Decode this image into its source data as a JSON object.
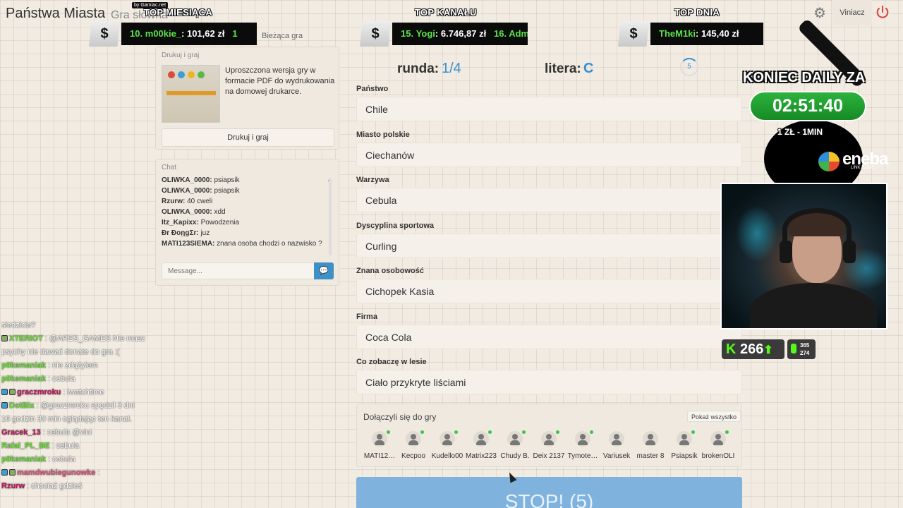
{
  "header": {
    "app_title": "Państwa Miasta",
    "app_subtitle": "Gra słowna",
    "settings_icon": "gear-icon",
    "user_label": "Viniacz",
    "power_icon": "power-icon",
    "by_gamiac": "by Gamiac.net",
    "current_game_label": "Bieżąca gra"
  },
  "donations": {
    "top_month": {
      "title": "TOP MIESIĄCA",
      "rank": "10.",
      "name": "m00kie_",
      "amount": ": 101,62 zł",
      "next": "1"
    },
    "top_channel": {
      "title": "TOP KANAŁU",
      "rank": "15.",
      "name": "Yogi",
      "amount": ": 6.746,87 zł",
      "next": "16. Adm"
    },
    "top_day": {
      "title": "TOP DNIA",
      "name": "TheM1ki",
      "amount": ": 145,40 zł"
    }
  },
  "print_panel": {
    "title": "Drukuj i graj",
    "description": "Uproszczona wersja gry w formacie PDF do wydrukowania na domowej drukarce.",
    "button_label": "Drukuj i graj"
  },
  "chat": {
    "title": "Chat",
    "messages": [
      {
        "user": "OLIWKA_0000:",
        "text": "psiapsik"
      },
      {
        "user": "OLIWKA_0000:",
        "text": "psiapsik"
      },
      {
        "user": "Rzurw:",
        "text": "40 cweli"
      },
      {
        "user": "OLIWKA_0000:",
        "text": "xdd"
      },
      {
        "user": "Itz_Kapixx:",
        "text": "Powodzenia"
      },
      {
        "user": "Đr ĐoῃgΣr:",
        "text": "juz"
      },
      {
        "user": "MATI123SIEMA:",
        "text": "znana osoba chodzi o nazwisko ?"
      }
    ],
    "input_placeholder": "Message...",
    "send_icon": "chat-bubble-icon"
  },
  "stream_chat": [
    {
      "user": "",
      "text": "siedzicie?",
      "color": "#ffffff"
    },
    {
      "user": "XTERIOT",
      "text": ": @ARES_GAMES Nie masz",
      "color": "#6fdc3a"
    },
    {
      "user": "",
      "text": "psychy nie dawać donate do gra :(",
      "color": "#ffffff"
    },
    {
      "user": "p0kemaniak",
      "text": ": nie zdążyłem",
      "color": "#6fdc3a"
    },
    {
      "user": "p0kemaniak",
      "text": ": cebula",
      "color": "#6fdc3a"
    },
    {
      "user": "graczmroku",
      "text": ": iwatchtime",
      "color": "#c2185b"
    },
    {
      "user": "DotBix",
      "text": ": @graczmroku spędził 3 dni",
      "color": "#6fdc3a"
    },
    {
      "user": "",
      "text": "16 godzin 30 min oglądając ten kanał.",
      "color": "#ffffff"
    },
    {
      "user": "Gracek_13",
      "text": ": cebula @vini",
      "color": "#c2185b"
    },
    {
      "user": "Rafal_PL_BE",
      "text": ": cebula",
      "color": "#6fdc3a"
    },
    {
      "user": "p0kemaniak",
      "text": ": cebula",
      "color": "#6fdc3a"
    },
    {
      "user": "mamdwubiegunowke",
      "text": ":",
      "color": "#e0557d"
    },
    {
      "user": "Rzurw",
      "text": ": chociaż gdzieś",
      "color": "#c2185b"
    }
  ],
  "game": {
    "round_label": "runda:",
    "round_value": "1/4",
    "letter_label": "litera:",
    "letter_value": "C",
    "countdown": "5",
    "fields": [
      {
        "label": "Państwo",
        "value": "Chile"
      },
      {
        "label": "Miasto polskie",
        "value": "Ciechanów"
      },
      {
        "label": "Warzywa",
        "value": "Cebula"
      },
      {
        "label": "Dyscyplina sportowa",
        "value": "Curling"
      },
      {
        "label": "Znana osobowość",
        "value": "Cichopek Kasia"
      },
      {
        "label": "Firma",
        "value": "Coca Cola"
      },
      {
        "label": "Co zobaczę w lesie",
        "value": "Ciało przykryte liściami"
      }
    ],
    "joined_title": "Dołączyli się do gry",
    "show_all_label": "Pokaż wszystko",
    "players": [
      "MATI12…",
      "Kecpoo",
      "Kudello00",
      "Matrix223",
      "Chudy B.",
      "Deix 2137",
      "Tymote…",
      "Variusek",
      "master 8",
      "Psiapsik",
      "brokenOLI"
    ],
    "stop_label": "STOP! (5)"
  },
  "overlay": {
    "koniec_label": "KONIEC DAILY ZA",
    "timer": "02:51:40",
    "rate": "1 ZŁ - 1MIN",
    "sponsor": "eneba",
    "sponsor_sub": "LINK IN BIO",
    "kick_count": "266",
    "viewers_a": "365",
    "viewers_b": "274"
  }
}
